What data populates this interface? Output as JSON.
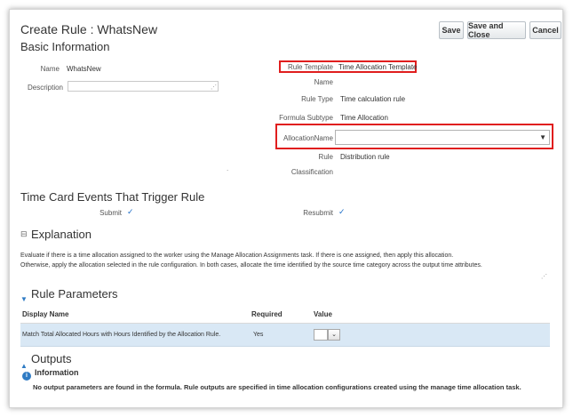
{
  "page": {
    "title": "Create Rule : WhatsNew",
    "buttons": {
      "save": "Save",
      "save_close": "Save and Close",
      "cancel": "Cancel"
    }
  },
  "basic": {
    "heading": "Basic Information",
    "name_label": "Name",
    "name_value": "WhatsNew",
    "description_label": "Description",
    "description_value": "",
    "rule_template_label": "Rule Template",
    "rule_template_value": "Time Allocation Template",
    "name2_label": "Name",
    "rule_type_label": "Rule Type",
    "rule_type_value": "Time calculation rule",
    "formula_subtype_label": "Formula Subtype",
    "formula_subtype_value": "Time Allocation",
    "allocation_name_label": "AllocationName",
    "allocation_name_value": "",
    "rule_classification_label_1": "Rule",
    "rule_classification_label_2": "Classification",
    "rule_classification_value": "Distribution rule",
    "dot": "."
  },
  "events": {
    "heading": "Time Card Events That Trigger Rule",
    "submit_label": "Submit",
    "resubmit_label": "Resubmit",
    "check": "✓"
  },
  "explanation": {
    "heading": "Explanation",
    "line1": "Evaluate if there is a time allocation assigned to the worker using the Manage Allocation Assignments task. If there is one assigned, then apply this allocation.",
    "line2": "Otherwise, apply the allocation selected in the rule configuration. In both cases, allocate the time identified by the source time category across the output time attributes."
  },
  "parameters": {
    "heading": "Rule Parameters",
    "columns": [
      "Display Name",
      "Required",
      "Value"
    ],
    "rows": [
      {
        "display_name": "Match Total Allocated Hours with Hours Identified by the Allocation Rule.",
        "required": "Yes"
      }
    ]
  },
  "outputs": {
    "heading": "Outputs",
    "info_heading": "Information",
    "info_text": "No output parameters are found in the formula. Rule outputs are specified in time allocation configurations created using the manage time allocation task."
  },
  "colors": {
    "highlight_red": "#e01e1e",
    "link_blue": "#2f7bc4",
    "row_selected": "#d9e8f5"
  }
}
